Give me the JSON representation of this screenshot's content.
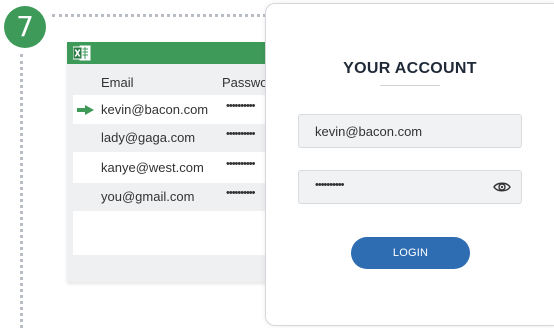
{
  "step": {
    "number": "7"
  },
  "spreadsheet": {
    "app_icon": "excel-icon",
    "columns": [
      "Email",
      "Passwo"
    ],
    "rows": [
      {
        "email": "kevin@bacon.com",
        "password": "••••••••••",
        "highlighted": true
      },
      {
        "email": "lady@gaga.com",
        "password": "••••••••••",
        "highlighted": false
      },
      {
        "email": "kanye@west.com",
        "password": "••••••••••",
        "highlighted": false
      },
      {
        "email": "you@gmail.com",
        "password": "••••••••••",
        "highlighted": false
      }
    ]
  },
  "login": {
    "title": "YOUR ACCOUNT",
    "email_value": "kevin@bacon.com",
    "password_value": "••••••••••",
    "show_password_icon": "eye-icon",
    "button_label": "LOGIN"
  },
  "colors": {
    "accent_green": "#3e9a58",
    "button_blue": "#2f6db3",
    "sheet_gray": "#eef0f2"
  }
}
